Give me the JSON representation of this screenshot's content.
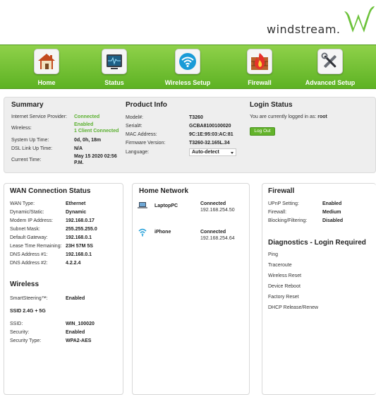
{
  "brand": {
    "name": "windstream."
  },
  "nav": {
    "items": [
      {
        "label": "Home",
        "icon": "house-icon"
      },
      {
        "label": "Status",
        "icon": "monitor-icon"
      },
      {
        "label": "Wireless Setup",
        "icon": "wifi-icon"
      },
      {
        "label": "Firewall",
        "icon": "firewall-icon"
      },
      {
        "label": "Advanced Setup",
        "icon": "tools-icon"
      }
    ]
  },
  "summary": {
    "title": "Summary",
    "isp_label": "Internet Service Provider:",
    "isp_value": "Connected",
    "wireless_label": "Wireless:",
    "wireless_value1": "Enabled",
    "wireless_value2": "1 Client Connected",
    "uptime_label": "System Up Time:",
    "uptime_value": "0d, 0h, 18m",
    "dsl_label": "DSL Link Up Time:",
    "dsl_value": "N/A",
    "time_label": "Current Time:",
    "time_value1": "May 15 2020 02:56",
    "time_value2": "P.M."
  },
  "product": {
    "title": "Product Info",
    "model_label": "Model#:",
    "model_value": "T3260",
    "serial_label": "Serial#:",
    "serial_value": "GCBA8100100020",
    "mac_label": "MAC Address:",
    "mac_value": "9C:1E:95:03:AC:81",
    "fw_label": "Firmware Version:",
    "fw_value": "T3260-32.165L.34",
    "lang_label": "Language:",
    "lang_value": "Auto-detect"
  },
  "login": {
    "title": "Login Status",
    "text": "You are currently logged in as:",
    "user": "root",
    "logout_label": "Log Out"
  },
  "wan": {
    "title": "WAN Connection Status",
    "rows": [
      {
        "label": "WAN Type:",
        "value": "Ethernet"
      },
      {
        "label": "Dynamic/Static:",
        "value": "Dynamic"
      },
      {
        "label": "Modem IP Address:",
        "value": "192.168.0.17"
      },
      {
        "label": "Subnet Mask:",
        "value": "255.255.255.0"
      },
      {
        "label": "Default Gateway:",
        "value": "192.168.0.1"
      },
      {
        "label": "Lease Time Remaining:",
        "value": "23H 57M 5S"
      },
      {
        "label": "DNS Address #1:",
        "value": "192.168.0.1"
      },
      {
        "label": "DNS Address #2:",
        "value": "4.2.2.4"
      }
    ]
  },
  "wireless": {
    "title": "Wireless",
    "steering_label": "SmartSteering™:",
    "steering_value": "Enabled",
    "ssid_group": "SSID 2.4G + 5G",
    "ssid_label": "SSID:",
    "ssid_value": "WIN_100020",
    "security_label": "Security:",
    "security_value": "Enabled",
    "sectype_label": "Security Type:",
    "sectype_value": "WPA2-AES"
  },
  "home_network": {
    "title": "Home Network",
    "devices": [
      {
        "name": "LaptopPC",
        "status": "Connected",
        "ip": "192.168.254.50",
        "icon": "laptop-icon"
      },
      {
        "name": "iPhone",
        "status": "Connected",
        "ip": "192.168.254.64",
        "icon": "wifi-device-icon"
      }
    ]
  },
  "firewall": {
    "title": "Firewall",
    "rows": [
      {
        "label": "UPnP Setting:",
        "value": "Enabled"
      },
      {
        "label": "Firewall:",
        "value": "Medium"
      },
      {
        "label": "Blocking/Filtering:",
        "value": "Disabled"
      }
    ]
  },
  "diagnostics": {
    "title": "Diagnostics - Login Required",
    "links": [
      "Ping",
      "Traceroute",
      "Wireless Reset",
      "Device Reboot",
      "Factory Reset",
      "DHCP Release/Renew"
    ]
  },
  "colors": {
    "accent_green": "#63b32a",
    "nav_top": "#8fd14a",
    "nav_bottom": "#5db223"
  }
}
